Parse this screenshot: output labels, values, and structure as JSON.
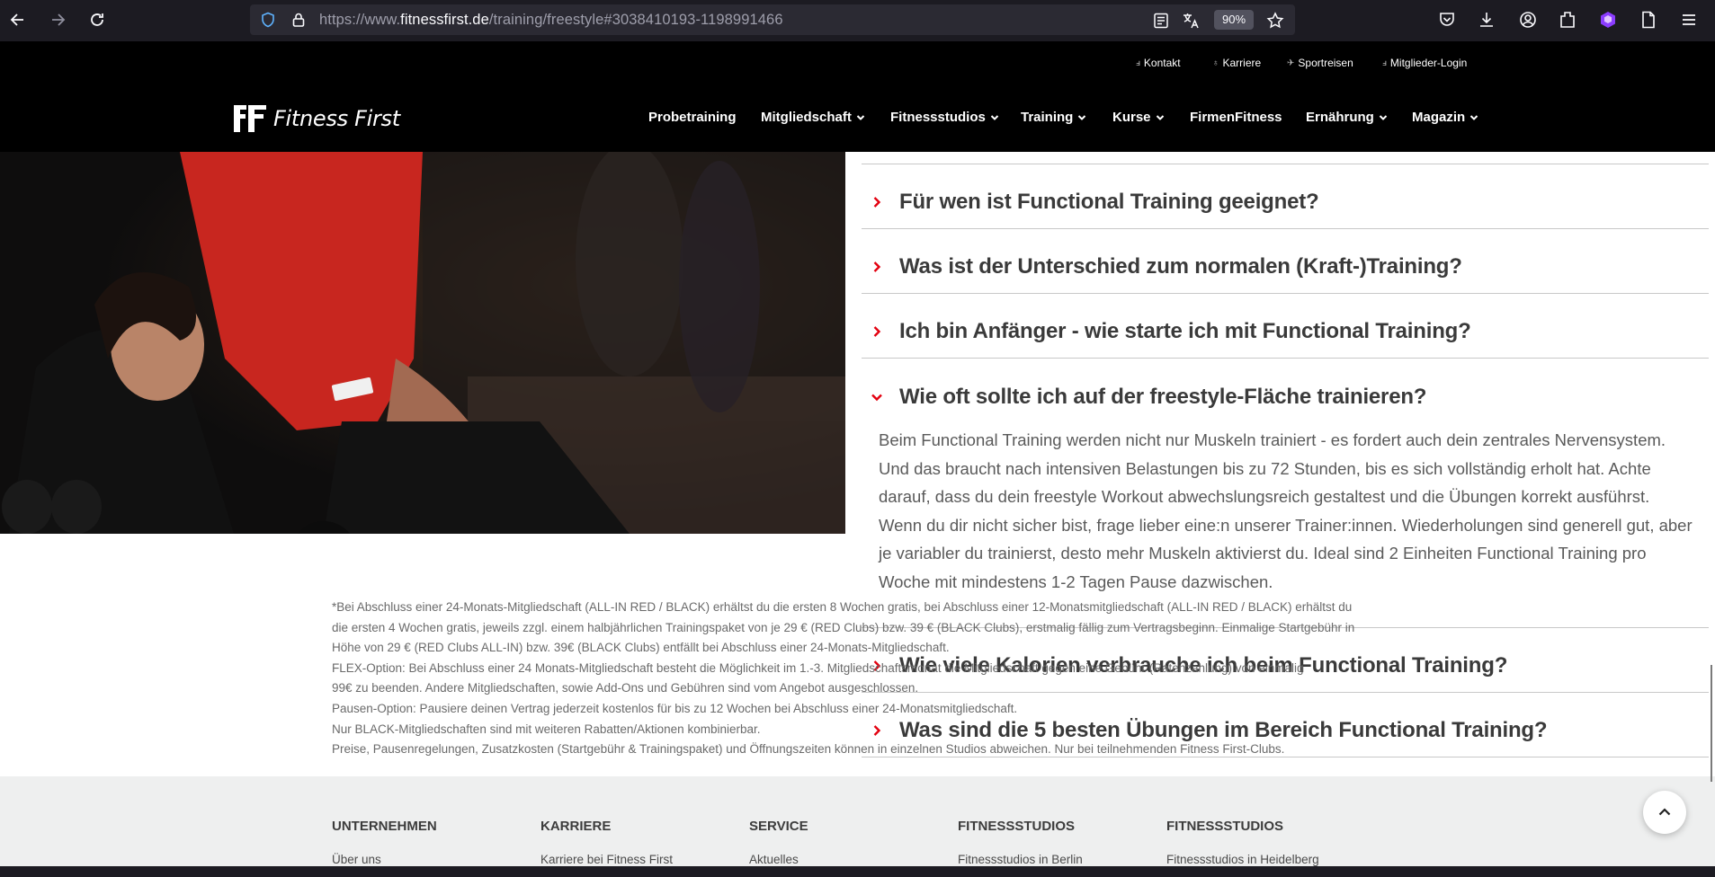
{
  "browser": {
    "url_prefix": "https://www.",
    "url_domain": "fitnessfirst.de",
    "url_path": "/training/freestyle#3038410193-1198991466",
    "zoom": "90%"
  },
  "topbar": {
    "links": [
      "Kontakt",
      "Karriere",
      "Sportreisen",
      "Mitglieder-Login"
    ]
  },
  "brand": {
    "name": "Fitness First"
  },
  "nav": {
    "items": [
      "Probetraining",
      "Mitgliedschaft",
      "Fitnessstudios",
      "Training",
      "Kurse",
      "FirmenFitness",
      "Ernährung",
      "Magazin"
    ]
  },
  "faq": {
    "items": [
      "Für wen ist Functional Training geeignet?",
      "Was ist der Unterschied zum normalen (Kraft-)Training?",
      "Ich bin Anfänger - wie starte ich mit Functional Training?",
      "Wie oft sollte ich auf der freestyle-Fläche trainieren?",
      "Wie viele Kalorien verbrauche ich beim Functional Training?",
      "Was sind die 5 besten Übungen im Bereich Functional Training?"
    ],
    "answer": "Beim Functional Training werden nicht nur Muskeln trainiert - es fordert auch dein zentrales Nervensystem. Und das braucht nach intensiven Belastungen bis zu 72 Stunden, bis es sich vollständig erholt hat. Achte darauf, dass du dein freestyle Workout abwechslungsreich gestaltest und die Übungen korrekt ausführst. Wenn du dir nicht sicher bist, frage lieber eine:n unserer Trainer:innen. Wiederholungen sind generell gut, aber je variabler du trainierst, desto mehr Muskeln aktivierst du. Ideal sind 2 Einheiten Functional Training pro Woche mit mindestens 1-2 Tagen Pause dazwischen."
  },
  "footnote": {
    "lines": [
      "*Bei Abschluss einer 24-Monats-Mitgliedschaft (ALL-IN RED / BLACK) erhältst du die ersten 8 Wochen gratis, bei Abschluss einer 12-Monatsmitgliedschaft (ALL-IN RED / BLACK) erhältst du",
      "die ersten 4 Wochen gratis, jeweils zzgl. einem halbjährlichen Trainingspaket von je 29 € (RED Clubs) bzw. 39 € (BLACK Clubs), erstmalig fällig zum Vertragsbeginn. Einmalige Startgebühr in",
      "Höhe von 29 € (RED Clubs ALL-IN) bzw. 39€ (BLACK Clubs) entfällt bei Abschluss einer 24-Monats-Mitgliedschaft.",
      "FLEX-Option: Bei Abschluss einer 24 Monats-Mitgliedschaft besteht die Möglichkeit im 1.-3. Mitgliedschaftsmonat die Mitgliedschaft gegen eine Gebühr (Ratenzahlung) von einmalig",
      "99€ zu beenden. Andere Mitgliedschaften, sowie Add-Ons und Gebühren sind vom Angebot ausgeschlossen.",
      "Pausen-Option: Pausiere deinen Vertrag jederzeit kostenlos für bis zu 12 Wochen bei Abschluss einer 24-Monatsmitgliedschaft.",
      "Nur BLACK-Mitgliedschaften sind mit weiteren Rabatten/Aktionen kombinierbar.",
      "Preise, Pausenregelungen, Zusatzkosten (Startgebühr & Trainingspaket) und Öffnungszeiten können in einzelnen Studios abweichen. Nur bei teilnehmenden Fitness First-Clubs."
    ]
  },
  "footer": {
    "columns": [
      {
        "heading": "UNTERNEHMEN",
        "link": "Über uns"
      },
      {
        "heading": "KARRIERE",
        "link": "Karriere bei Fitness First"
      },
      {
        "heading": "SERVICE",
        "link": "Aktuelles"
      },
      {
        "heading": "FITNESSSTUDIOS",
        "link": "Fitnessstudios in Berlin"
      },
      {
        "heading": "FITNESSSTUDIOS",
        "link": "Fitnessstudios in Heidelberg"
      }
    ]
  },
  "colors": {
    "accent": "#e3000f",
    "browser_chrome": "#1c1b22",
    "nav_background": "#000000",
    "footer_background": "#eeefef"
  },
  "icons": [
    "back-icon",
    "forward-icon",
    "reload-icon",
    "shield-icon",
    "lock-icon",
    "reader-view-icon",
    "translate-icon",
    "star-icon",
    "pocket-icon",
    "download-icon",
    "account-icon",
    "extensions-icon",
    "extension-puzzle-icon",
    "page-icon",
    "menu-icon",
    "chevron-up-icon"
  ]
}
